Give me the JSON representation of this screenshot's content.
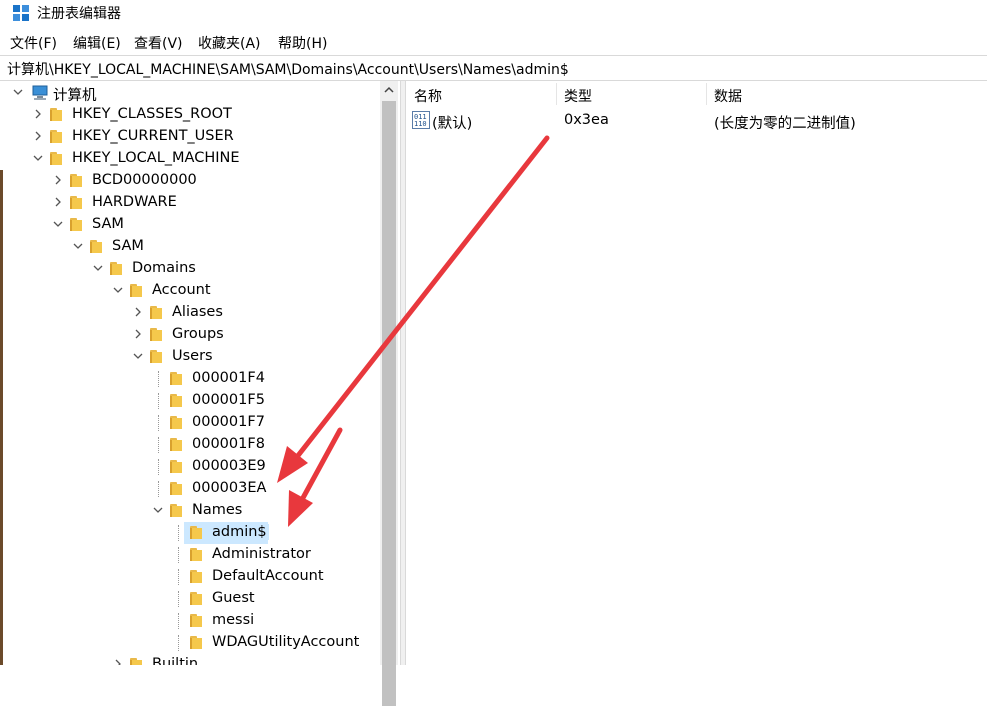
{
  "window": {
    "title": "注册表编辑器"
  },
  "menu": [
    "文件(F)",
    "编辑(E)",
    "查看(V)",
    "收藏夹(A)",
    "帮助(H)"
  ],
  "address": "计算机\\HKEY_LOCAL_MACHINE\\SAM\\SAM\\Domains\\Account\\Users\\Names\\admin$",
  "tree": {
    "root": "计算机",
    "nodes": [
      {
        "label": "HKEY_CLASSES_ROOT",
        "depth": 1,
        "state": "collapsed"
      },
      {
        "label": "HKEY_CURRENT_USER",
        "depth": 1,
        "state": "collapsed"
      },
      {
        "label": "HKEY_LOCAL_MACHINE",
        "depth": 1,
        "state": "expanded"
      },
      {
        "label": "BCD00000000",
        "depth": 2,
        "state": "collapsed"
      },
      {
        "label": "HARDWARE",
        "depth": 2,
        "state": "collapsed"
      },
      {
        "label": "SAM",
        "depth": 2,
        "state": "expanded"
      },
      {
        "label": "SAM",
        "depth": 3,
        "state": "expanded"
      },
      {
        "label": "Domains",
        "depth": 4,
        "state": "expanded"
      },
      {
        "label": "Account",
        "depth": 5,
        "state": "expanded"
      },
      {
        "label": "Aliases",
        "depth": 6,
        "state": "collapsed"
      },
      {
        "label": "Groups",
        "depth": 6,
        "state": "collapsed"
      },
      {
        "label": "Users",
        "depth": 6,
        "state": "expanded"
      },
      {
        "label": "000001F4",
        "depth": 7,
        "state": "leaf"
      },
      {
        "label": "000001F5",
        "depth": 7,
        "state": "leaf"
      },
      {
        "label": "000001F7",
        "depth": 7,
        "state": "leaf"
      },
      {
        "label": "000001F8",
        "depth": 7,
        "state": "leaf"
      },
      {
        "label": "000003E9",
        "depth": 7,
        "state": "leaf"
      },
      {
        "label": "000003EA",
        "depth": 7,
        "state": "leaf"
      },
      {
        "label": "Names",
        "depth": 7,
        "state": "expanded"
      },
      {
        "label": "admin$",
        "depth": 8,
        "state": "leaf",
        "selected": true
      },
      {
        "label": "Administrator",
        "depth": 8,
        "state": "leaf"
      },
      {
        "label": "DefaultAccount",
        "depth": 8,
        "state": "leaf"
      },
      {
        "label": "Guest",
        "depth": 8,
        "state": "leaf"
      },
      {
        "label": "messi",
        "depth": 8,
        "state": "leaf"
      },
      {
        "label": "WDAGUtilityAccount",
        "depth": 8,
        "state": "leaf"
      },
      {
        "label": "Builtin",
        "depth": 5,
        "state": "collapsed"
      }
    ]
  },
  "list": {
    "headers": {
      "name": "名称",
      "type": "类型",
      "data": "数据"
    },
    "rows": [
      {
        "name": "(默认)",
        "type": "0x3ea",
        "data": "(长度为零的二进制值)",
        "icon": "binary-value-icon"
      }
    ]
  },
  "colors": {
    "arrow": "#e8383d",
    "selection": "#cce8ff",
    "folder": "#f5c84c",
    "scrollbar_thumb": "#c1c1c1"
  }
}
